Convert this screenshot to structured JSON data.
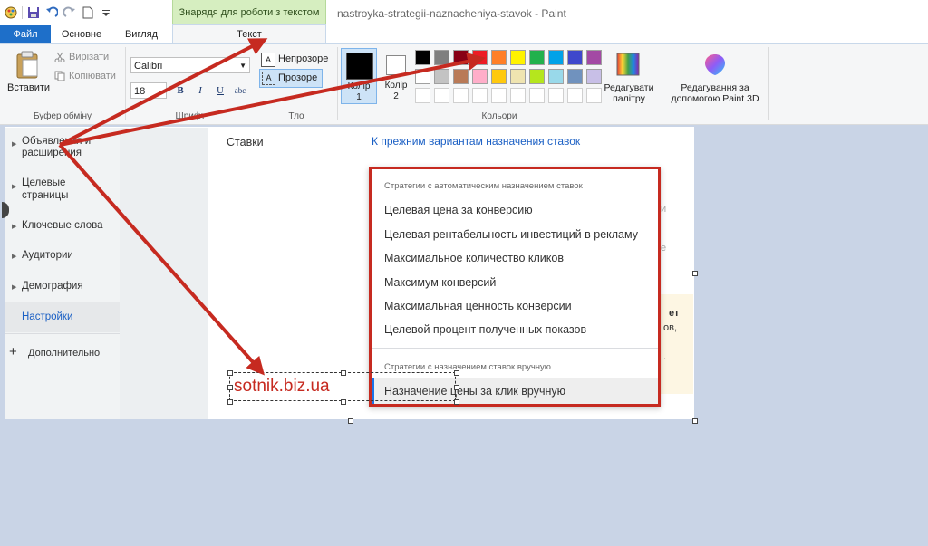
{
  "window": {
    "title": "nastroyka-strategii-naznacheniya-stavok - Paint"
  },
  "context_tab_group": "Знарядя для роботи з текстом",
  "tabs": {
    "file": "Файл",
    "home": "Основне",
    "view": "Вигляд",
    "text": "Текст"
  },
  "ribbon": {
    "clipboard": {
      "paste": "Вставити",
      "cut": "Вирізати",
      "copy": "Копіювати",
      "group": "Буфер обміну"
    },
    "font": {
      "family": "Calibri",
      "size": "18",
      "bold": "B",
      "italic": "I",
      "underline": "U",
      "strike": "abc",
      "group": "Шрифт"
    },
    "background": {
      "opaque": "Непрозоре",
      "transparent": "Прозоре",
      "group": "Тло"
    },
    "colors": {
      "color1_a": "Колір",
      "color1_b": "1",
      "color2_a": "Колір",
      "color2_b": "2",
      "edit_a": "Редагувати",
      "edit_b": "палітру",
      "group": "Кольори",
      "color1_value": "#000000",
      "color2_value": "#ffffff",
      "palette_row1": [
        "#000000",
        "#7f7f7f",
        "#880015",
        "#ed1c24",
        "#ff7f27",
        "#fff200",
        "#22b14c",
        "#00a2e8",
        "#3f48cc",
        "#a349a4"
      ],
      "palette_row2": [
        "#ffffff",
        "#c3c3c3",
        "#b97a57",
        "#ffaec9",
        "#ffc90e",
        "#efe4b0",
        "#b5e61d",
        "#99d9ea",
        "#7092be",
        "#c8bfe7"
      ]
    },
    "paint3d": {
      "line1": "Редагування за",
      "line2": "допомогою Paint 3D"
    }
  },
  "ads": {
    "sidebar": [
      {
        "label1": "Объявления и",
        "label2": "расширения"
      },
      {
        "label1": "Целевые",
        "label2": "страницы"
      },
      {
        "label1": "Ключевые слова"
      },
      {
        "label1": "Аудитории"
      },
      {
        "label1": "Демография"
      },
      {
        "label1": "Настройки"
      }
    ],
    "more": "Дополнительно",
    "bids_label": "Ставки",
    "prev_link": "К прежним вариантам назначения ставок",
    "menu": {
      "auto_header": "Стратегии с автоматическим назначением ставок",
      "auto_items": [
        "Целевая цена за конверсию",
        "Целевая рентабельность инвестиций в рекламу",
        "Максимальное количество кликов",
        "Максимум конверсий",
        "Максимальная ценность конверсии",
        "Целевой процент полученных показов"
      ],
      "manual_header": "Стратегии с назначением ставок вручную",
      "manual_item": "Назначение цены за клик вручную"
    },
    "clipped_right": [
      "ет",
      "ов,",
      "."
    ]
  },
  "watermark": "sotnik.biz.ua",
  "annotation_color": "#c62a20"
}
